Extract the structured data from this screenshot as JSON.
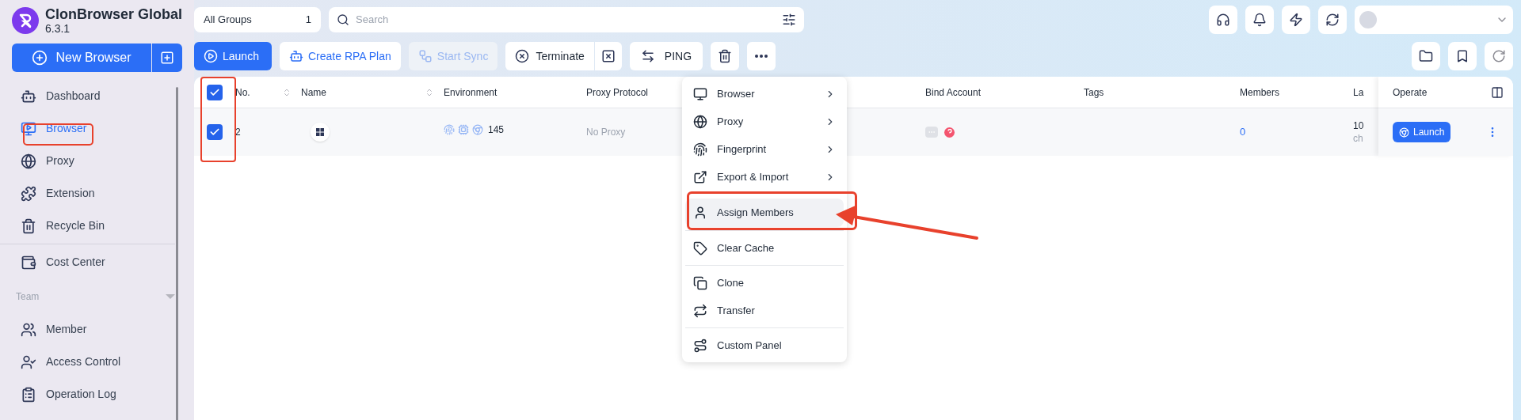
{
  "app": {
    "name": "ClonBrowser Global",
    "version": "6.3.1"
  },
  "new_browser": {
    "label": "New Browser"
  },
  "sidebar": {
    "groups": [
      {
        "items": [
          {
            "label": "Dashboard",
            "selected": false
          },
          {
            "label": "Browser",
            "selected": true
          },
          {
            "label": "Proxy",
            "selected": false
          },
          {
            "label": "Extension",
            "selected": false
          },
          {
            "label": "Recycle Bin",
            "selected": false
          }
        ]
      },
      {
        "items": [
          {
            "label": "Cost Center",
            "selected": false
          }
        ]
      },
      {
        "title": "Team",
        "expanded": true,
        "items": [
          {
            "label": "Member",
            "selected": false
          },
          {
            "label": "Access Control",
            "selected": false
          },
          {
            "label": "Operation Log",
            "selected": false
          }
        ]
      }
    ]
  },
  "group_selector": {
    "label": "All Groups",
    "count": "1"
  },
  "search": {
    "placeholder": "Search"
  },
  "toolbar": [
    {
      "label": "Launch",
      "kind": "primary",
      "disabled": false
    },
    {
      "label": "Create RPA Plan",
      "kind": "outline",
      "disabled": false
    },
    {
      "label": "Start Sync",
      "kind": "outline",
      "disabled": true
    },
    {
      "label": "Terminate",
      "kind": "split",
      "disabled": false
    },
    {
      "label": "PING",
      "kind": "plain",
      "disabled": false
    },
    {
      "kind": "icon",
      "disabled": false
    },
    {
      "kind": "icon",
      "disabled": false
    }
  ],
  "table": {
    "header_checked": true,
    "columns": [
      {
        "label": "No.",
        "sortable": true
      },
      {
        "label": "Name",
        "sortable": true
      },
      {
        "label": "Environment",
        "sortable": false
      },
      {
        "label": "Proxy Protocol",
        "sortable": false
      },
      {
        "label": "Bind Account",
        "sortable": false
      },
      {
        "label": "Tags",
        "sortable": false
      },
      {
        "label": "Members",
        "sortable": false
      },
      {
        "label": "La",
        "sortable": false
      },
      {
        "label": "Operate",
        "sortable": false
      }
    ],
    "rows": [
      {
        "selected": true,
        "no": "2",
        "environment": "145",
        "proxy": "No Proxy",
        "members": "0",
        "last": "10",
        "last_sub": "ch",
        "launch": "Launch"
      }
    ]
  },
  "context_menu": [
    {
      "label": "Browser",
      "submenu": true,
      "selected": false,
      "divider_before": false
    },
    {
      "label": "Proxy",
      "submenu": true,
      "selected": false,
      "divider_before": false
    },
    {
      "label": "Fingerprint",
      "submenu": true,
      "selected": false,
      "divider_before": false
    },
    {
      "label": "Export & Import",
      "submenu": true,
      "selected": false,
      "divider_before": false
    },
    {
      "label": "Assign Members",
      "submenu": false,
      "selected": true,
      "divider_before": false
    },
    {
      "label": "Clear Cache",
      "submenu": false,
      "selected": false,
      "divider_before": true
    },
    {
      "label": "Clone",
      "submenu": false,
      "selected": false,
      "divider_before": true
    },
    {
      "label": "Transfer",
      "submenu": false,
      "selected": false,
      "divider_before": false
    },
    {
      "label": "Custom Panel",
      "submenu": false,
      "selected": false,
      "divider_before": true
    }
  ]
}
